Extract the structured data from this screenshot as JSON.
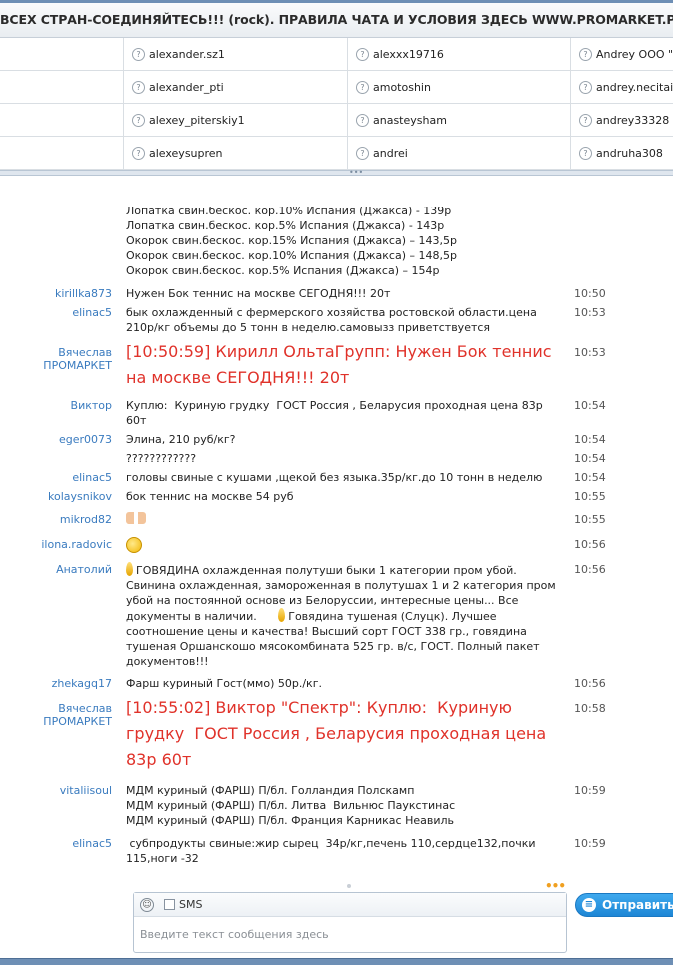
{
  "title": "ВСЕХ СТРАН-СОЕДИНЯЙТЕСЬ!!! (rock). ПРАВИЛА ЧАТА И УСЛОВИЯ ЗДЕСЬ WWW.PROMARKET.PRO",
  "users": [
    [
      "",
      "alexander.sz1",
      "alexxx19716",
      "Andrey OOO \"M"
    ],
    [
      "",
      "alexander_pti",
      "amotoshin",
      "andrey.necitaile"
    ],
    [
      "",
      "alexey_piterskiy1",
      "anasteysham",
      "andrey33328"
    ],
    [
      "",
      "alexeysupren",
      "andrei",
      "andruha308"
    ]
  ],
  "messages": [
    {
      "who": "",
      "time": "",
      "text": "Лопатка свин.бескос. кор.10% Испания (Джакса) - 139р\nЛопатка свин.бескос. кор.5% Испания (Джакса) - 143р\nОкорок свин.бескос. кор.15% Испания (Джакса) – 143,5р\nОкорок свин.бескос. кор.10% Испания (Джакса) – 148,5р\nОкорок свин.бескос. кор.5% Испания (Джакса) – 154р",
      "big": false
    },
    {
      "who": "kirillka873",
      "time": "10:50",
      "text": "Нужен Бок теннис на москве СЕГОДНЯ!!! 20т",
      "big": false
    },
    {
      "who": "elinac5",
      "time": "10:53",
      "text": "бык охлажденный с фермерского хозяйства ростовской области.цена 210р/кг объемы до 5 тонн в неделю.самовызз приветствуется",
      "big": false
    },
    {
      "who": "Вячеслав ПРОМАРКЕТ",
      "time": "10:53",
      "text": "[10:50:59] Кирилл ОльтаГрупп: Нужен Бок теннис на москве СЕГОДНЯ!!! 20т",
      "big": true
    },
    {
      "who": "Виктор",
      "time": "10:54",
      "text": "Куплю:  Куриную грудку  ГОСТ Россия , Беларусия проходная цена 83р 60т",
      "big": false
    },
    {
      "who": "eger0073",
      "time": "10:54",
      "text": "Элина, 210 руб/кг?",
      "big": false
    },
    {
      "who": "",
      "time": "10:54",
      "text": "????????????",
      "big": false
    },
    {
      "who": "elinac5",
      "time": "10:54",
      "text": "головы свиные с кушами ,щекой без языка.35р/кг.до 10 тонн в неделю",
      "big": false
    },
    {
      "who": "kolaysnikov",
      "time": "10:55",
      "text": "бок теннис на москве 54 руб",
      "big": false
    },
    {
      "who": "mikrod82",
      "time": "10:55",
      "text": "",
      "big": false
    },
    {
      "who": "ilona.radovic",
      "time": "10:56",
      "text": "",
      "big": false
    },
    {
      "who": "Анатолий",
      "time": "10:56",
      "text": "ГОВЯДИНА охлажденная полутуши быки 1 категории пром убой. Свинина охлажденная, замороженная в полутушах 1 и 2 категория пром убой на постоянной основе из Белоруссии, интересные цены... Все документы в наличии.",
      "text2": "Говядина тушеная (Слуцк). Лучшее соотношение цены и качества! Высший сорт ГОСТ 338 гр., говядина тушеная Оршанскошо мясокомбината 525 гр. в/с, ГОСТ. Полный пакет документов!!!",
      "big": false
    },
    {
      "who": "zhekagq17",
      "time": "10:56",
      "text": "Фарш куриный Гост(ммо) 50р./кг.",
      "big": false
    },
    {
      "who": "Вячеслав ПРОМАРКЕТ",
      "time": "10:58",
      "text": "[10:55:02] Виктор \"Спектр\": Куплю:  Куриную грудку  ГОСТ Россия , Беларусия проходная цена 83р 60т",
      "big": true
    },
    {
      "who": "vitaliisoul",
      "time": "10:59",
      "text": "МДМ куриный (ФАРШ) П/бл. Голландия Полскамп\nМДМ куриный (ФАРШ) П/бл. Литва  Вильнюс Паукстинас\nМДМ куриный (ФАРШ) П/бл. Франция Карникас Неавиль",
      "big": false
    },
    {
      "who": "elinac5",
      "time": "10:59",
      "text": " субпродукты свиные:жир сырец  34р/кг,печень 110,сердце132,почки 115,ноги -32",
      "big": false
    }
  ],
  "input": {
    "sms_label": "SMS",
    "placeholder": "Введите текст сообщения здесь"
  },
  "send_label": "Отправить",
  "icons": {
    "user_status": "question-icon",
    "emoji": "smile-icon",
    "send": "send-icon"
  },
  "colors": {
    "accent": "#3a7bbf",
    "highlight": "#e0322a",
    "button": "#1d86d5"
  }
}
